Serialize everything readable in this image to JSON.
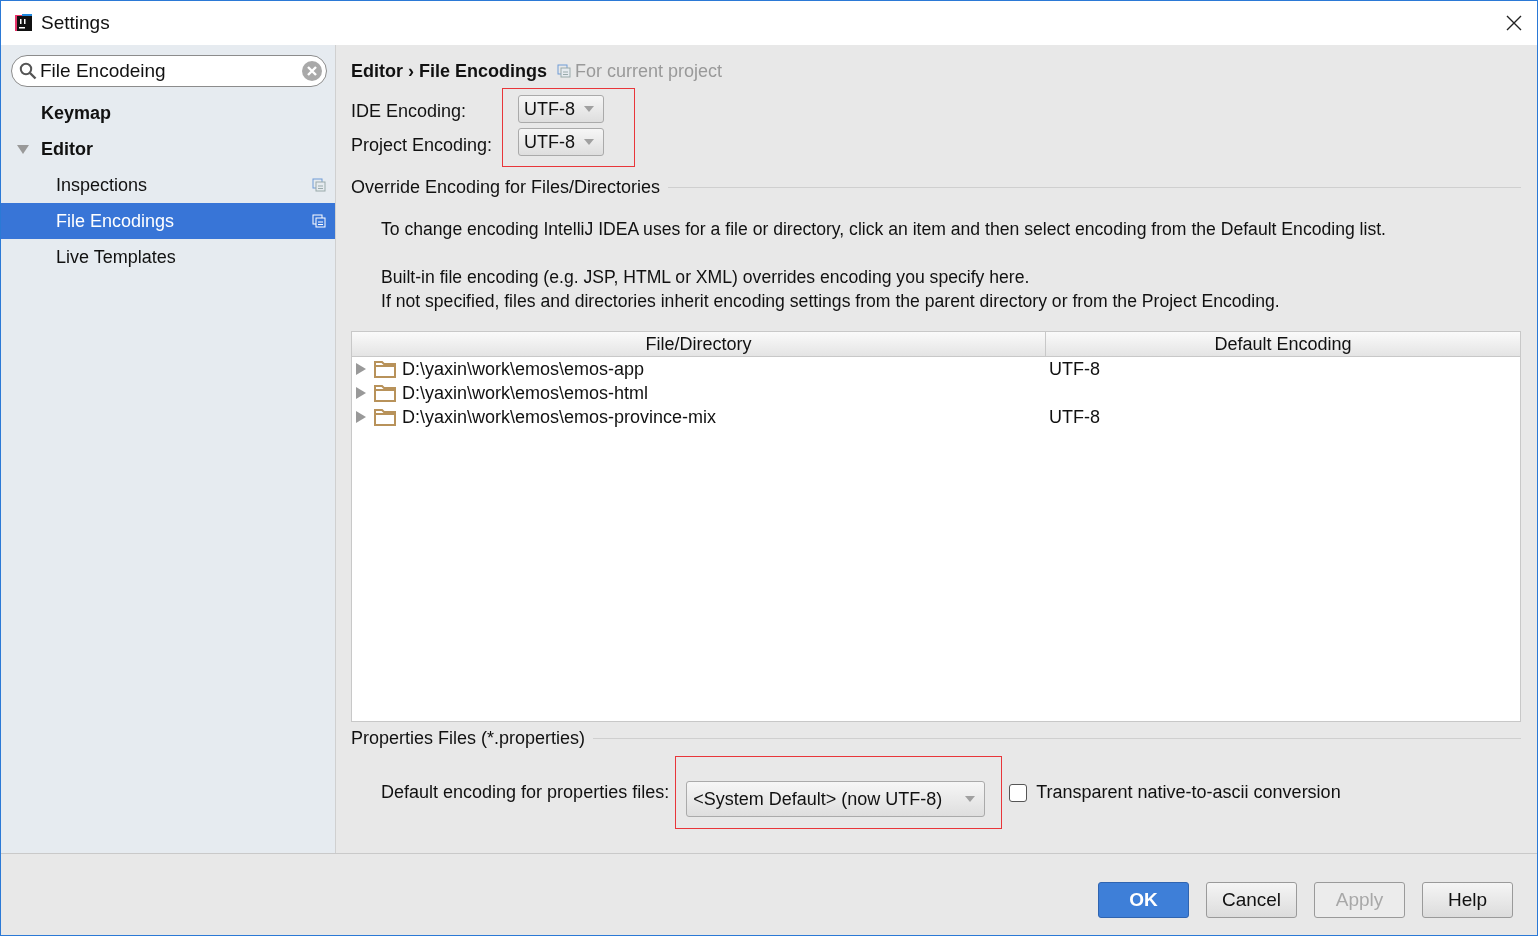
{
  "window": {
    "title": "Settings"
  },
  "search": {
    "value": "File Encodeing"
  },
  "sidebar": {
    "items": [
      {
        "label": "Keymap",
        "selected": false,
        "project_scope": false
      },
      {
        "label": "Editor",
        "selected": false,
        "expanded": true,
        "project_scope": false,
        "children": [
          {
            "label": "Inspections",
            "selected": false,
            "project_scope": true
          },
          {
            "label": "File Encodings",
            "selected": true,
            "project_scope": true
          },
          {
            "label": "Live Templates",
            "selected": false,
            "project_scope": false
          }
        ]
      }
    ]
  },
  "breadcrumb": {
    "path": "Editor › File Encodings",
    "scope": "For current project"
  },
  "encodings": {
    "highlighted": true,
    "fields": [
      {
        "label": "IDE Encoding:",
        "value": "UTF-8"
      },
      {
        "label": "Project Encoding:",
        "value": "UTF-8"
      }
    ]
  },
  "override": {
    "title": "Override Encoding for Files/Directories",
    "notes": [
      "To change encoding IntelliJ IDEA uses for a file or directory, click an item and then select encoding from the Default Encoding list.",
      "Built-in file encoding (e.g. JSP, HTML or XML) overrides encoding you specify here.",
      "If not specified, files and directories inherit encoding settings from the parent directory or from the Project Encoding."
    ],
    "table": {
      "columns": [
        "File/Directory",
        "Default Encoding"
      ],
      "rows": [
        {
          "path": "D:\\yaxin\\work\\emos\\emos-app",
          "encoding": "UTF-8",
          "expanded": false
        },
        {
          "path": "D:\\yaxin\\work\\emos\\emos-html",
          "expanded": false
        },
        {
          "path": "D:\\yaxin\\work\\emos\\emos-province-mix",
          "encoding": "UTF-8",
          "expanded": false
        }
      ]
    }
  },
  "properties": {
    "title": "Properties Files (*.properties)",
    "label": "Default encoding for properties files:",
    "value": "<System Default> (now UTF-8)",
    "highlighted": true,
    "checkbox": {
      "label": "Transparent native-to-ascii conversion",
      "checked": false
    }
  },
  "buttons": [
    {
      "label": "OK",
      "kind": "default",
      "disabled": false
    },
    {
      "label": "Cancel",
      "kind": "normal",
      "disabled": false
    },
    {
      "label": "Apply",
      "kind": "normal",
      "disabled": true
    },
    {
      "label": "Help",
      "kind": "normal",
      "disabled": false
    }
  ]
}
